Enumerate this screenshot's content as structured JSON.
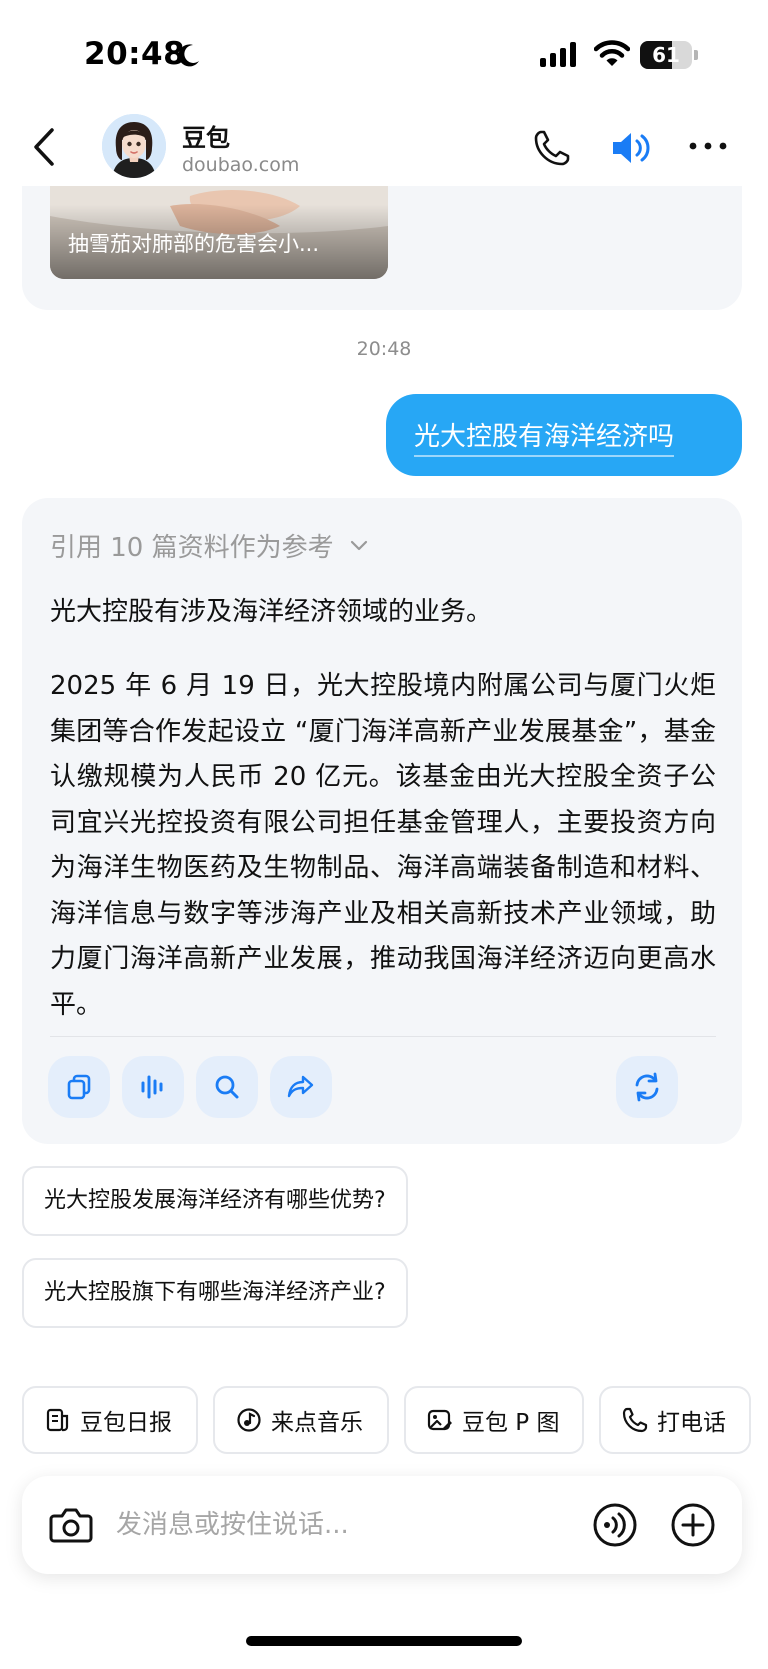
{
  "status_bar": {
    "time": "20:48",
    "moon_icon": "moon-icon",
    "signal_icon": "cellular-signal-icon",
    "wifi_icon": "wifi-icon",
    "battery_level": "61",
    "battery_fraction": 0.61
  },
  "header": {
    "back_icon": "chevron-left-icon",
    "title": "豆包",
    "subtitle": "doubao.com",
    "phone_icon": "phone-icon",
    "speaker_icon": "speaker-icon",
    "more_icon": "more-icon",
    "accent_color": "#1a7cf5"
  },
  "previous_card": {
    "caption": "抽雪茄对肺部的危害会小..."
  },
  "chat": {
    "timestamp": "20:48",
    "user_message": "光大控股有海洋经济吗",
    "user_bubble_color": "#27a7f5",
    "answer": {
      "references_label": "引用 10 篇资料作为参考",
      "paragraph_1": "光大控股有涉及海洋经济领域的业务。",
      "paragraph_2": "2025 年 6 月 19 日，光大控股境内附属公司与厦门火炬集团等合作发起设立 “厦门海洋高新产业发展基金”，基金认缴规模为人民币 20 亿元。该基金由光大控股全资子公司宜兴光控投资有限公司担任基金管理人，主要投资方向为海洋生物医药及生物制品、海洋高端装备制造和材料、海洋信息与数字等涉海产业及相关高新技术产业领域，助力厦门海洋高新产业发展，推动我国海洋经济迈向更高水平。",
      "actions": [
        "copy-icon",
        "voice-wave-icon",
        "search-icon",
        "share-icon",
        "refresh-icon"
      ]
    },
    "suggestions": [
      "光大控股发展海洋经济有哪些优势?",
      "光大控股旗下有哪些海洋经济产业?"
    ]
  },
  "quick_actions": [
    {
      "label": "豆包日报",
      "icon": "daily-news-icon"
    },
    {
      "label": "来点音乐",
      "icon": "music-icon"
    },
    {
      "label": "豆包 P 图",
      "icon": "image-edit-icon"
    },
    {
      "label": "打电话",
      "icon": "phone-icon"
    }
  ],
  "input": {
    "placeholder": "发消息或按住说话...",
    "value": "",
    "camera_icon": "camera-icon",
    "voice_icon": "voice-call-icon",
    "plus_icon": "plus-icon"
  }
}
